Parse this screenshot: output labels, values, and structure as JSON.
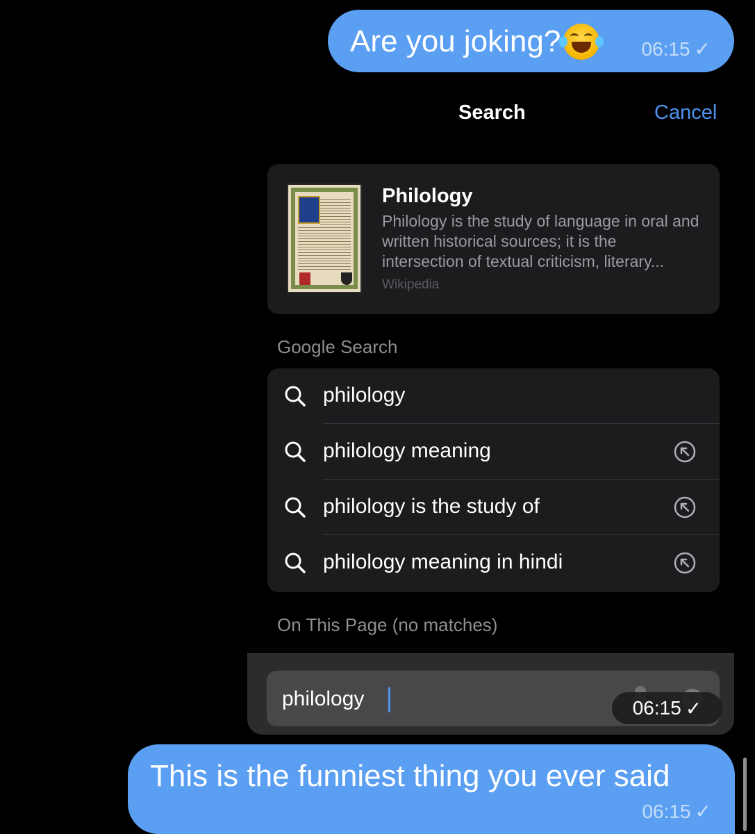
{
  "messages": {
    "top": {
      "text": "Are you joking?",
      "emoji": "face-with-tears-of-joy",
      "time": "06:15",
      "status": "✓"
    },
    "bottom": {
      "text": "This is the funniest thing you ever said",
      "time": "06:15",
      "status": "✓"
    }
  },
  "search": {
    "title": "Search",
    "cancel_label": "Cancel"
  },
  "wiki_card": {
    "title": "Philology",
    "description": "Philology is the study of language in oral and written historical sources; it is the intersection of textual criticism, literary...",
    "source": "Wikipedia",
    "thumbnail": "illuminated-manuscript-image"
  },
  "google_search": {
    "header": "Google Search",
    "suggestions": [
      {
        "label": "philology",
        "fill_icon": false
      },
      {
        "label": "philology meaning",
        "fill_icon": true
      },
      {
        "label": "philology is the study of",
        "fill_icon": true
      },
      {
        "label": "philology meaning in hindi",
        "fill_icon": true
      }
    ]
  },
  "on_this_page": {
    "header": "On This Page (no matches)"
  },
  "find_bar": {
    "value": "philology",
    "time_overlay": "06:15",
    "status": "✓"
  },
  "colors": {
    "bubble": "#5b9ff2",
    "accent": "#4f93ef",
    "panel": "#1c1c1e",
    "background": "#000000"
  }
}
